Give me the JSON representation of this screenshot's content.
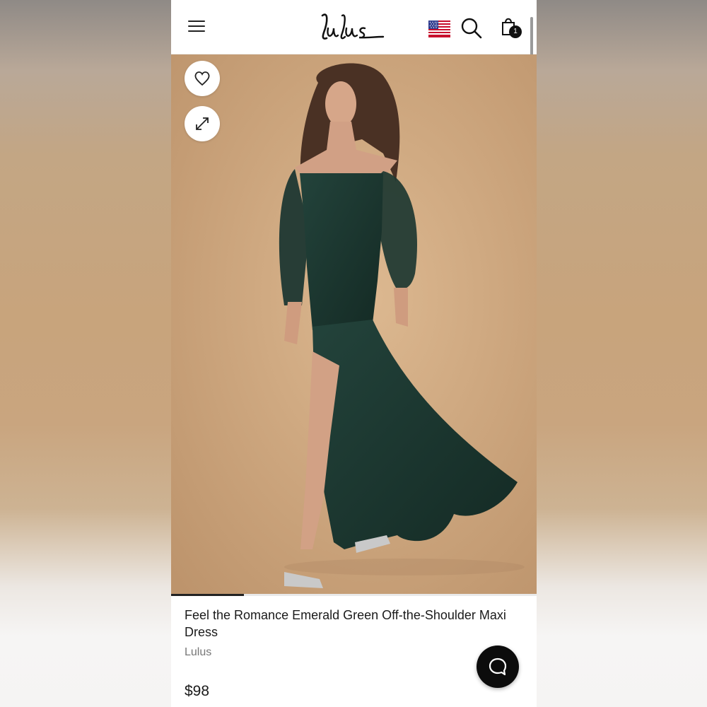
{
  "header": {
    "menu_icon": "hamburger-menu-icon",
    "logo_text": "Lulus",
    "flag_icon": "us-flag-icon",
    "search_icon": "search-icon",
    "bag_icon": "shopping-bag-icon",
    "bag_count": "1"
  },
  "gallery": {
    "favorite_icon": "heart-icon",
    "expand_icon": "expand-icon",
    "image_progress": 0.2
  },
  "product": {
    "title": "Feel the Romance Emerald Green Off-the-Shoulder Maxi Dress",
    "brand": "Lulus",
    "price": "$98"
  },
  "chat": {
    "icon": "chat-bubble-icon"
  },
  "colors": {
    "dress": "#1f3a33",
    "backdrop": "#c9a27c",
    "accent": "#111111"
  }
}
